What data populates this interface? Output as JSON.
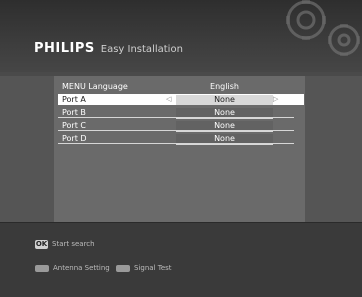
{
  "header": {
    "brand": "PHILIPS",
    "title": "Easy Installation"
  },
  "menu": {
    "header_row": {
      "label": "MENU Language",
      "value": "English"
    },
    "rows": [
      {
        "label": "Port A",
        "value": "None",
        "selected": true
      },
      {
        "label": "Port B",
        "value": "None",
        "selected": false
      },
      {
        "label": "Port C",
        "value": "None",
        "selected": false
      },
      {
        "label": "Port D",
        "value": "None",
        "selected": false
      }
    ]
  },
  "footer": {
    "ok_key": "OK",
    "ok_label": "Start search",
    "red_label": "Antenna Setting",
    "green_label": "Signal Test"
  }
}
